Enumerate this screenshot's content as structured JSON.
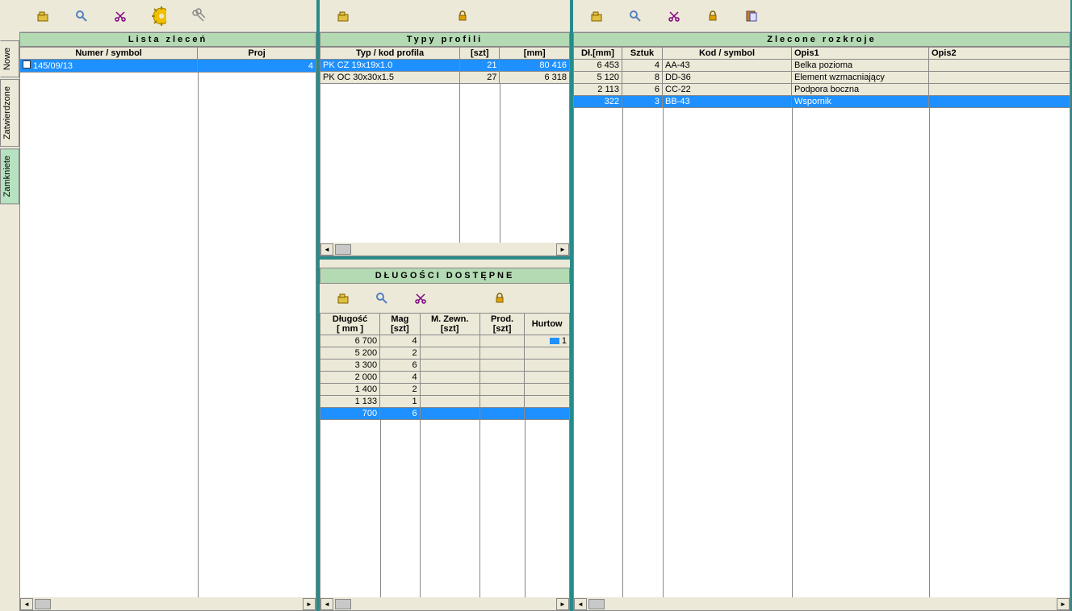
{
  "side_tabs": {
    "nowe": "Nowe",
    "zatw": "Zatwierdzone",
    "zamk": "Zamkniete"
  },
  "left": {
    "title": "Lista zleceń",
    "headers": {
      "numer": "Numer / symbol",
      "proj": "Proj"
    },
    "rows": [
      {
        "numer": "145/09/13",
        "proj": "4",
        "selected": true
      }
    ]
  },
  "mid_top": {
    "title": "Typy profili",
    "headers": {
      "typ": "Typ / kod profila",
      "szt": "[szt]",
      "mm": "[mm]"
    },
    "rows": [
      {
        "typ": "PK  CZ  19x19x1.0",
        "szt": "21",
        "mm": "80 416",
        "selected": true
      },
      {
        "typ": "PK  OC  30x30x1.5",
        "szt": "27",
        "mm": "6 318"
      }
    ]
  },
  "mid_bottom": {
    "title": "DŁUGOŚCI  DOSTĘPNE",
    "headers": {
      "dl1": "Długość",
      "dl2": "[ mm ]",
      "mag1": "Mag",
      "mag2": "[szt]",
      "mz1": "M. Zewn.",
      "mz2": "[szt]",
      "prod1": "Prod.",
      "prod2": "[szt]",
      "hurt1": "Hurtow"
    },
    "rows": [
      {
        "dl": "6 700",
        "mag": "4",
        "mz": "",
        "prod": "",
        "hurt": "1",
        "hurt_icon": true
      },
      {
        "dl": "5 200",
        "mag": "2",
        "mz": "",
        "prod": "",
        "hurt": ""
      },
      {
        "dl": "3 300",
        "mag": "6",
        "mz": "",
        "prod": "",
        "hurt": ""
      },
      {
        "dl": "2 000",
        "mag": "4",
        "mz": "",
        "prod": "",
        "hurt": ""
      },
      {
        "dl": "1 400",
        "mag": "2",
        "mz": "",
        "prod": "",
        "hurt": ""
      },
      {
        "dl": "1 133",
        "mag": "1",
        "mz": "",
        "prod": "",
        "hurt": ""
      },
      {
        "dl": "700",
        "mag": "6",
        "mz": "",
        "prod": "",
        "hurt": "",
        "selected": true
      }
    ]
  },
  "right": {
    "title": "Zlecone rozkroje",
    "headers": {
      "dl": "Dł.[mm]",
      "szt": "Sztuk",
      "kod": "Kod / symbol",
      "op1": "Opis1",
      "op2": "Opis2"
    },
    "rows": [
      {
        "dl": "6 453",
        "szt": "4",
        "kod": "AA-43",
        "op1": "Belka pozioma",
        "op2": ""
      },
      {
        "dl": "5 120",
        "szt": "8",
        "kod": "DD-36",
        "op1": "Element wzmacniający",
        "op2": ""
      },
      {
        "dl": "2 113",
        "szt": "6",
        "kod": "CC-22",
        "op1": "Podpora boczna",
        "op2": ""
      },
      {
        "dl": "322",
        "szt": "3",
        "kod": "BB-43",
        "op1": "Wspornik",
        "op2": "",
        "selected": true
      }
    ]
  }
}
